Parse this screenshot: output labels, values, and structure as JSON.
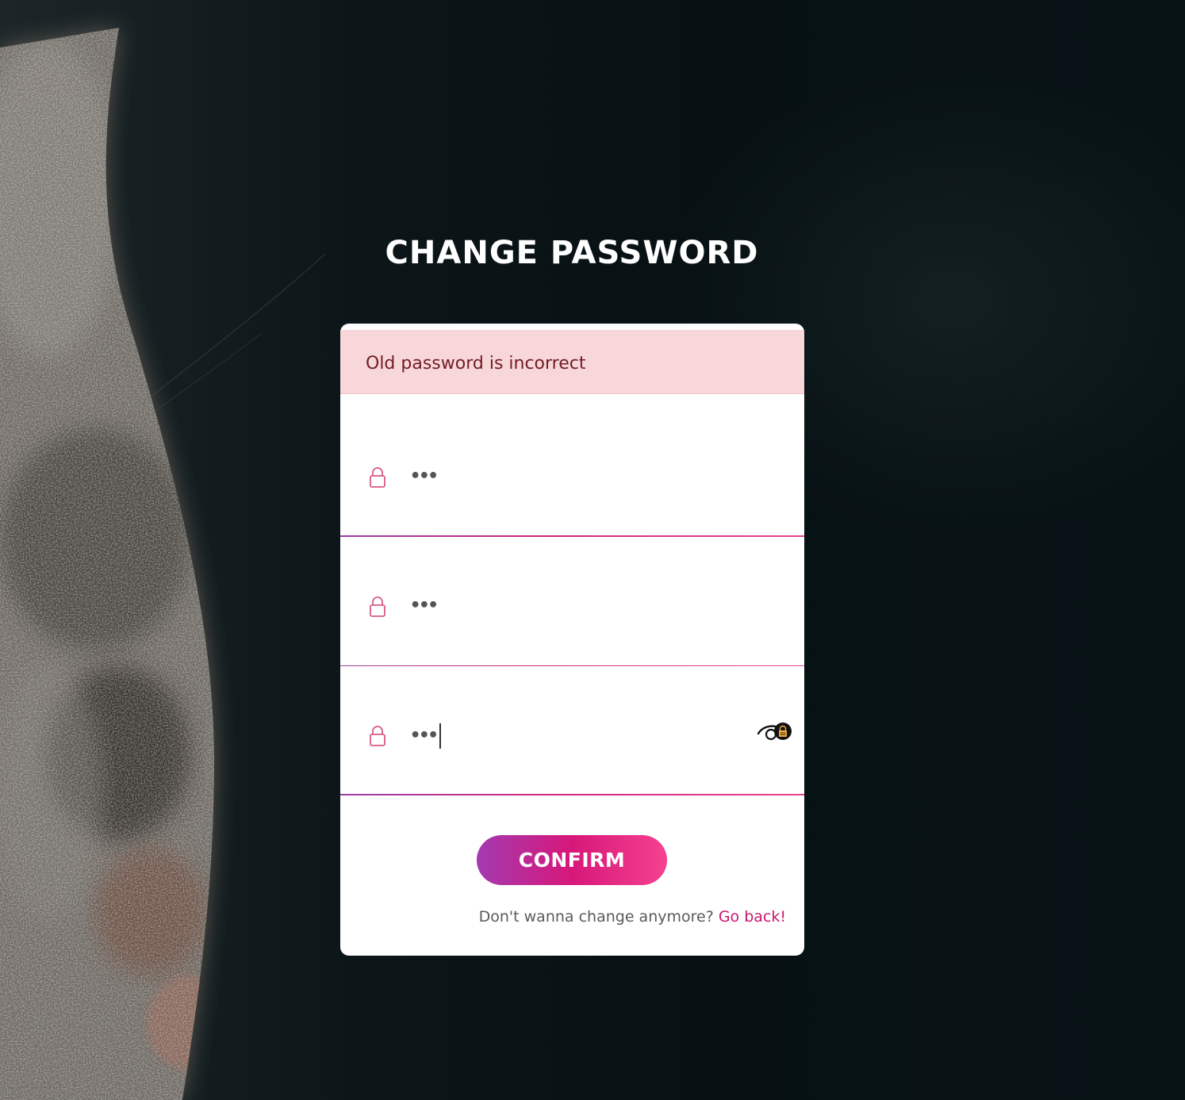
{
  "page": {
    "title": "CHANGE PASSWORD"
  },
  "alert": {
    "message": "Old password is incorrect",
    "background": "#f8d7da",
    "text_color": "#721c24"
  },
  "form": {
    "fields": [
      {
        "icon": "lock-icon",
        "value": "•••"
      },
      {
        "icon": "lock-icon",
        "value": "•••"
      },
      {
        "icon": "lock-icon",
        "value": "•••",
        "toggle_icon": "eye-toggle-icon"
      }
    ],
    "confirm_label": "CONFIRM",
    "footer_text": "Don't wanna change anymore?",
    "back_link": "Go back!"
  },
  "colors": {
    "accent": "#d7187a",
    "gradient_start": "#a33ab0",
    "gradient_end": "#f5428f"
  }
}
